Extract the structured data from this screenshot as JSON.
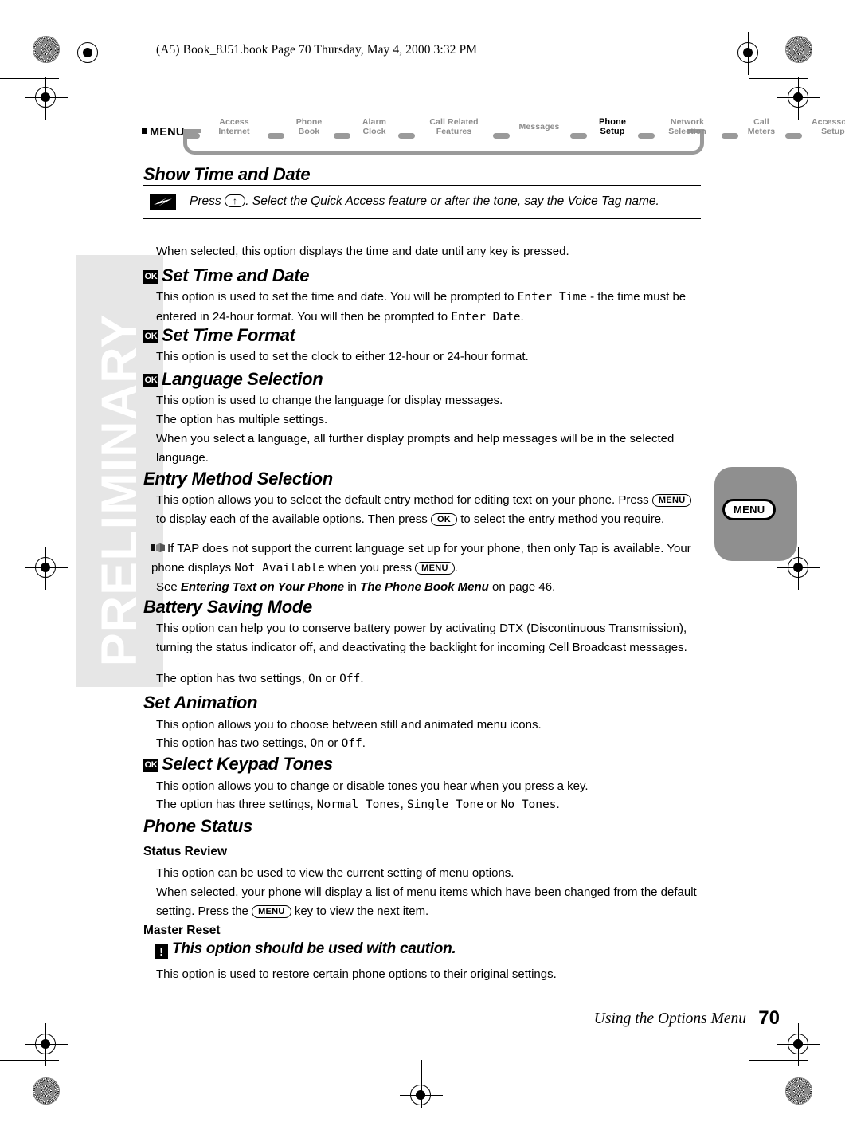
{
  "header": {
    "filestamp": "(A5) Book_8J51.book  Page 70  Thursday, May 4, 2000  3:32 PM"
  },
  "watermark": {
    "text": "PRELIMINARY"
  },
  "menu_path": {
    "label": "MENU",
    "items": [
      {
        "line1": "Access",
        "line2": "Internet",
        "active": false
      },
      {
        "line1": "Phone",
        "line2": "Book",
        "active": false
      },
      {
        "line1": "Alarm",
        "line2": "Clock",
        "active": false
      },
      {
        "line1": "Call Related",
        "line2": "Features",
        "active": false
      },
      {
        "line1": "Messages",
        "line2": "",
        "active": false
      },
      {
        "line1": "Phone",
        "line2": "Setup",
        "active": true
      },
      {
        "line1": "Network",
        "line2": "Selection",
        "active": false
      },
      {
        "line1": "Call",
        "line2": "Meters",
        "active": false
      },
      {
        "line1": "Accessory",
        "line2": "Setup",
        "active": false
      }
    ]
  },
  "sections": {
    "show_time_and_date": {
      "heading": "Show Time and Date",
      "quick_access": {
        "icon": "lightning-bolt-icon",
        "press_label": "Press",
        "key": "↑",
        "text": ". Select the Quick Access feature or after the tone, say the Voice Tag name."
      },
      "body": "When selected, this option displays the time and date until any key is pressed."
    },
    "set_time_and_date": {
      "badge": "OK",
      "heading": "Set Time and Date",
      "body_a": "This option is used to set the time and date. You will be prompted to ",
      "lcd_a": "Enter Time",
      "body_b": " - the time must be entered in 24-hour format. You will then be prompted to ",
      "lcd_b": "Enter Date",
      "body_c": "."
    },
    "set_time_format": {
      "badge": "OK",
      "heading": "Set Time Format",
      "body": "This option is used to set the clock to either 12-hour or 24-hour format."
    },
    "language_selection": {
      "badge": "OK",
      "heading": "Language Selection",
      "line1": "This option is used to change the language for display messages.",
      "line2": "The option has multiple settings.",
      "line3": "When you select a language, all further display prompts and help messages will be in the selected language."
    },
    "entry_method_selection": {
      "heading": "Entry Method Selection",
      "p1_a": "This option allows you to select the default entry method for editing text on your phone. Press ",
      "p1_key1": "MENU",
      "p1_b": " to display each of the available options. Then press ",
      "p1_key2": "OK",
      "p1_c": " to select the entry method you require.",
      "p2_icon": "note-pointer-icon",
      "p2_a": "If TAP does not support the current language set up for your phone, then only Tap is available. Your phone displays ",
      "p2_lcd": "Not Available",
      "p2_b": " when you press ",
      "p2_key": "MENU",
      "p2_c": ".",
      "p3_a": "See ",
      "p3_bold1": "Entering Text on Your Phone",
      "p3_b": " in ",
      "p3_bold2": "The Phone Book Menu",
      "p3_c": " on page 46."
    },
    "battery_saving_mode": {
      "heading": "Battery Saving Mode",
      "p1": "This option can help you to conserve battery power by activating DTX (Discontinuous Transmission), turning the status indicator off, and deactivating the backlight for incoming Cell Broadcast messages.",
      "p2_a": "The option has two settings, ",
      "p2_on": "On",
      "p2_mid": " or ",
      "p2_off": "Off",
      "p2_end": "."
    },
    "set_animation": {
      "heading": "Set Animation",
      "p1": "This option allows you to choose between still and animated menu icons.",
      "p2_a": "This option has two settings, ",
      "p2_on": "On",
      "p2_mid": " or ",
      "p2_off": "Off",
      "p2_end": "."
    },
    "select_keypad_tones": {
      "badge": "OK",
      "heading": "Select Keypad Tones",
      "p1": "This option allows you to change or disable tones you hear when you press a key.",
      "p2_a": "The option has three settings, ",
      "p2_lcd1": "Normal Tones",
      "p2_sep1": ", ",
      "p2_lcd2": "Single Tone",
      "p2_sep2": " or ",
      "p2_lcd3": "No Tones",
      "p2_end": "."
    },
    "phone_status": {
      "heading": "Phone Status",
      "status_review": {
        "heading": "Status Review",
        "p1": "This option can be used to view the current setting of menu options.",
        "p2_a": "When selected, your phone will display a list of menu items which have been changed from the default setting. Press the ",
        "p2_key": "MENU",
        "p2_b": " key to view the next item."
      },
      "master_reset": {
        "heading": "Master Reset",
        "caution_badge": "!",
        "caution": "This option should be used with caution.",
        "p1": "This option is used to restore certain phone options to their original settings."
      }
    }
  },
  "side_tab": {
    "key_label": "MENU"
  },
  "footer": {
    "title": "Using the Options Menu",
    "page": "70"
  }
}
